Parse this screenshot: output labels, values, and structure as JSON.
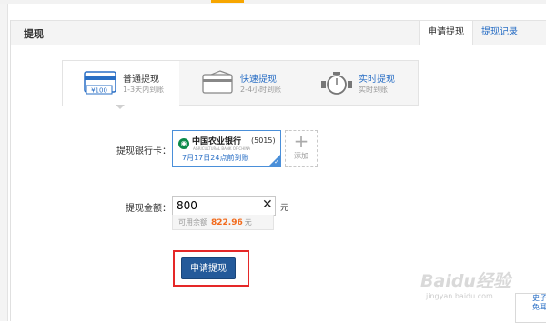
{
  "panel": {
    "title": "提现"
  },
  "tabs": [
    {
      "label": "申请提现",
      "active": true
    },
    {
      "label": "提现记录",
      "active": false
    }
  ],
  "methods": [
    {
      "title": "普通提现",
      "desc": "1-3天内到账",
      "icon": "bank-card-icon",
      "badge": "¥100"
    },
    {
      "title": "快速提现",
      "desc": "2-4小时到账",
      "icon": "fast-card-icon"
    },
    {
      "title": "实时提现",
      "desc": "实时到账",
      "icon": "stopwatch-icon"
    }
  ],
  "form": {
    "card_label": "提现银行卡：",
    "card": {
      "bank": "中国农业银行",
      "bank_en": "AGRICULTURAL BANK OF CHINA",
      "tail": "(5015)",
      "arrival": "7月17日24点前到账"
    },
    "add_label": "添加",
    "amount_label": "提现金额：",
    "amount_value": "800",
    "unit": "元",
    "available_label": "可用余额",
    "available_value": "822.96",
    "available_unit": "元",
    "submit_label": "申请提现"
  },
  "watermark": {
    "text": "Baidu经验",
    "sub": "jingyan.baidu.com"
  },
  "side": {
    "line1": "史子",
    "line2": "免耳"
  },
  "colors": {
    "accent": "#2a6fc5",
    "button": "#245a9a",
    "highlight": "#e52828",
    "balance": "#f26b1d"
  }
}
